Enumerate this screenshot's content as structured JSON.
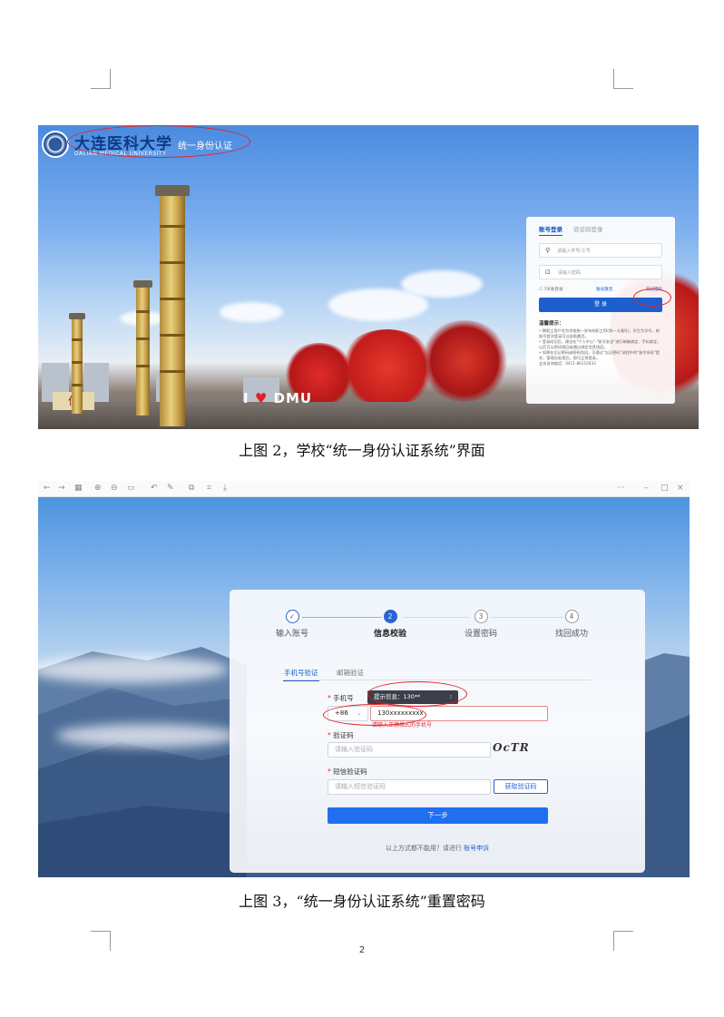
{
  "figure2": {
    "logo_cn": "大连医科大学",
    "logo_en": "DALIAN MEDICAL UNIVERSITY",
    "logo_system": "统一身份认证",
    "landmark_text_left": "I",
    "landmark_text_right": "DMU",
    "landmark_sign": "仁",
    "login": {
      "tab_account": "账号登录",
      "tab_code": "验证码登录",
      "username_placeholder": "请输入学号/工号",
      "password_placeholder": "请输入密码",
      "remember": "7天免登录",
      "forgot_account": "账号激活",
      "forgot_password": "忘记密码",
      "login_button": "登 录",
      "tips_title": "温馨提示：",
      "tips": [
        "• 教职工用户名为学校统一发布的职工ID(例一卡通号)，学生为学号，新账号首次登录可以自助激活。",
        "• 登录成功后，建议在\"个人中心\"-\"账号安全\"进行邮箱绑定、手机绑定，以后可以密码找回或通过绑定信息找回。",
        "• 如果在忘记密码或密码找回，可通过\"忘记密码\"流程中的\"账号申诉\"提交，管理员处理后，即可正常登录。",
        "  业务咨询电话：0411-86110433"
      ]
    },
    "caption": "上图 2，学校“统一身份认证系统”界面"
  },
  "figure3": {
    "toolbar_right": [
      "···",
      "–",
      "□",
      "×"
    ],
    "steps": [
      {
        "num": "✓",
        "label": "输入账号"
      },
      {
        "num": "2",
        "label": "信息校验"
      },
      {
        "num": "3",
        "label": "设置密码"
      },
      {
        "num": "4",
        "label": "找回成功"
      }
    ],
    "tab_phone": "手机号验证",
    "tab_email": "邮箱验证",
    "phone_label": "手机号",
    "tooltip": "提示信息：130**",
    "tooltip_close": "⁝",
    "country_code": "+86",
    "phone_value": "130xxxxxxxxx",
    "phone_error": "请输入正确格式的手机号",
    "captcha_label": "验证码",
    "captcha_placeholder": "请输入验证码",
    "captcha_image_text": "OcTR",
    "sms_label": "短信验证码",
    "sms_placeholder": "请输入短信验证码",
    "get_code": "获取验证码",
    "next": "下一步",
    "footer_text": "以上方式都不能用？请进行",
    "footer_link": "账号申诉",
    "caption": "上图 3，“统一身份认证系统”重置密码"
  },
  "page_number": "2",
  "colors": {
    "accent": "#1d5fcf",
    "annotation": "#e42424",
    "error": "#e02c2c"
  }
}
